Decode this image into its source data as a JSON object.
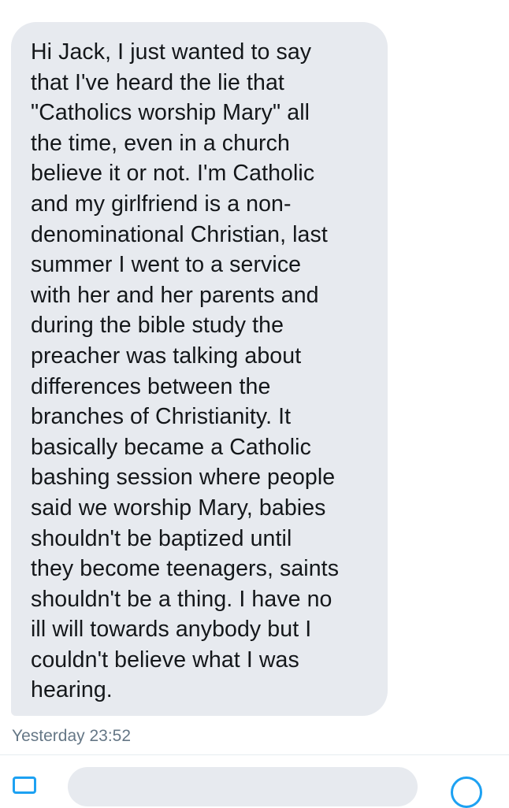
{
  "message": {
    "lines": [
      "Hi Jack, I just wanted to say",
      "that I've heard the lie that",
      "\"Catholics worship Mary\" all",
      "the time, even in a church",
      "believe it or not. I'm Catholic",
      "and my girlfriend is a non-",
      "denominational Christian, last",
      "summer I went to a service",
      "with her and her parents and",
      "during the bible study the",
      "preacher was talking about",
      "differences between the",
      "branches of Christianity. It",
      "basically became a Catholic",
      "bashing session where people",
      "said we worship Mary, babies",
      "shouldn't be baptized until",
      "they become teenagers, saints",
      "shouldn't be a thing. I have no",
      "ill will towards anybody but I",
      "couldn't believe what I was",
      "hearing."
    ],
    "timestamp": "Yesterday 23:52"
  },
  "composer": {
    "left_icon": "media-icon",
    "right_icon": "emoji-icon"
  },
  "colors": {
    "bubble_background": "#e7eaef",
    "text": "#14171a",
    "timestamp": "#657786",
    "accent": "#1da1f2"
  }
}
